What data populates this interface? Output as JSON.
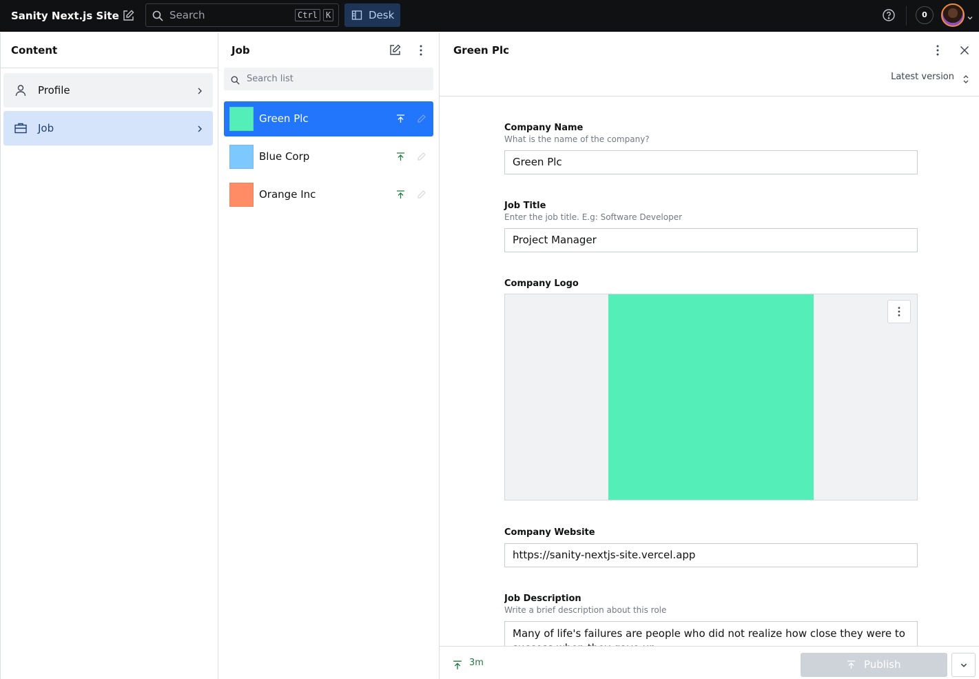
{
  "app": {
    "title": "Sanity Next.js Site",
    "search_placeholder": "Search",
    "shortcut_keys": [
      "Ctrl",
      "K"
    ],
    "tool_label": "Desk",
    "notification_count": "0"
  },
  "content_pane": {
    "title": "Content",
    "items": [
      {
        "label": "Profile",
        "icon": "user-icon",
        "selected": false
      },
      {
        "label": "Job",
        "icon": "briefcase-icon",
        "selected": true
      }
    ]
  },
  "list_pane": {
    "title": "Job",
    "search_placeholder": "Search list",
    "items": [
      {
        "label": "Green Plc",
        "color": "#54efb8",
        "selected": true
      },
      {
        "label": "Blue Corp",
        "color": "#7cc8ff",
        "selected": false
      },
      {
        "label": "Orange Inc",
        "color": "#ff8c64",
        "selected": false
      }
    ]
  },
  "document": {
    "title": "Green Plc",
    "version_label": "Latest version",
    "fields": {
      "company_name": {
        "label": "Company Name",
        "description": "What is the name of the company?",
        "value": "Green Plc"
      },
      "job_title": {
        "label": "Job Title",
        "description": "Enter the job title. E.g: Software Developer",
        "value": "Project Manager"
      },
      "company_logo": {
        "label": "Company Logo",
        "color": "#54efb8"
      },
      "company_website": {
        "label": "Company Website",
        "value": "https://sanity-nextjs-site.vercel.app"
      },
      "job_description": {
        "label": "Job Description",
        "description": "Write a brief description about this role",
        "value": "Many of life's failures are people who did not realize how close they were to success when they gave up."
      }
    },
    "footer": {
      "published_ago": "3m",
      "publish_label": "Publish"
    }
  },
  "colors": {
    "accent": "#2276fc",
    "topbar": "#101112",
    "selected_nav": "#d5e4fb",
    "publish_disabled": "#ced2d9",
    "published_green": "#1f7a3d"
  }
}
